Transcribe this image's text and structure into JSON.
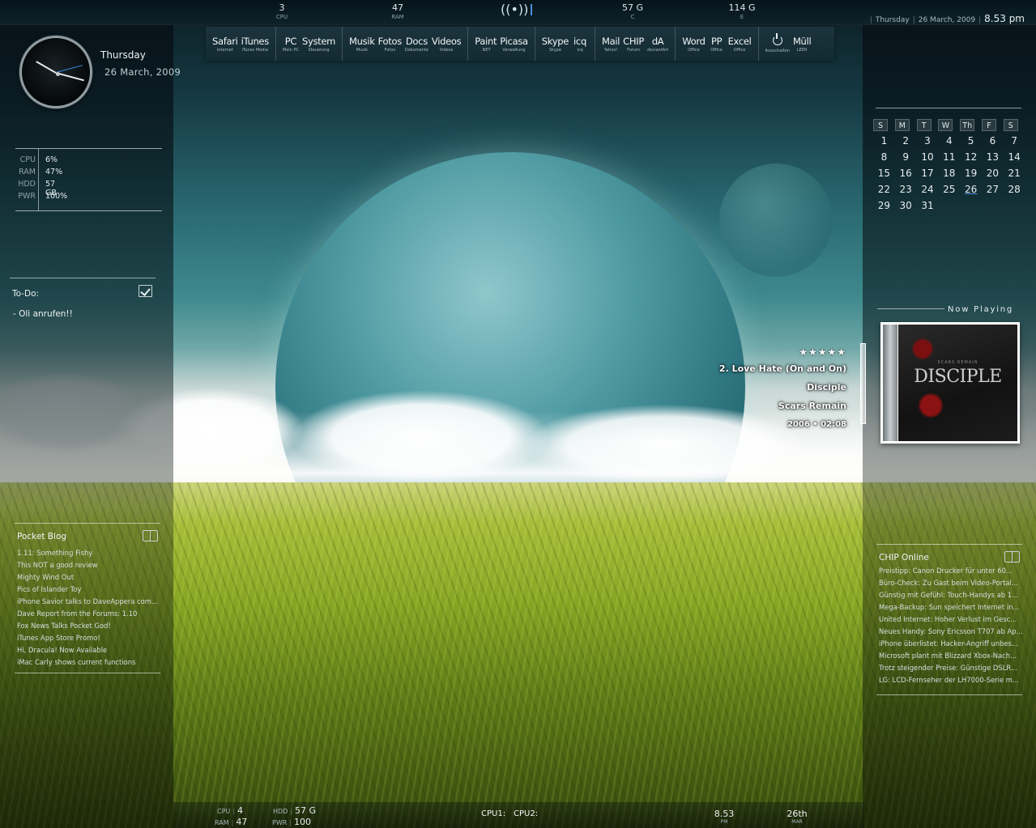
{
  "topbar": {
    "stats": [
      {
        "value": "3",
        "label": "CPU"
      },
      {
        "value": "47",
        "label": "RAM"
      },
      {
        "value": "57 G",
        "label": "C"
      },
      {
        "value": "114 G",
        "label": "E"
      }
    ],
    "date": "Thursday",
    "date_full": "26 March, 2009",
    "time": "8.53 pm"
  },
  "dock": {
    "groups": [
      [
        {
          "name": "Safari",
          "sub": "Internet"
        },
        {
          "name": "iTunes",
          "sub": "iTunes Media"
        }
      ],
      [
        {
          "name": "PC",
          "sub": "Mein PC"
        },
        {
          "name": "System",
          "sub": "Steuerung"
        }
      ],
      [
        {
          "name": "Musik",
          "sub": "Musik"
        },
        {
          "name": "Fotos",
          "sub": "Fotos"
        },
        {
          "name": "Docs",
          "sub": "Dokumente"
        },
        {
          "name": "Videos",
          "sub": "Videos"
        }
      ],
      [
        {
          "name": "Paint",
          "sub": ".NET"
        },
        {
          "name": "Picasa",
          "sub": "Verwaltung"
        }
      ],
      [
        {
          "name": "Skype",
          "sub": "Skype"
        },
        {
          "name": "icq",
          "sub": "icq"
        }
      ],
      [
        {
          "name": "Mail",
          "sub": "Yahoo!"
        },
        {
          "name": "CHIP",
          "sub": "Forum"
        },
        {
          "name": "dA",
          "sub": "deviantArt"
        }
      ],
      [
        {
          "name": "Word",
          "sub": "Office"
        },
        {
          "name": "PP",
          "sub": "Office"
        },
        {
          "name": "Excel",
          "sub": "Office"
        }
      ],
      [
        {
          "name": "",
          "sub": "Ausschalten",
          "icon": "power-icon"
        },
        {
          "name": "Müll",
          "sub": "LEER"
        }
      ]
    ]
  },
  "clock": {
    "day": "Thursday",
    "date": "26 March, 2009"
  },
  "system": {
    "rows": [
      {
        "label": "CPU",
        "value": "6%"
      },
      {
        "label": "RAM",
        "value": "47%"
      },
      {
        "label": "HDD",
        "value": "57 GB"
      },
      {
        "label": "PWR",
        "value": "100%"
      }
    ]
  },
  "todo": {
    "title": "To-Do:",
    "items": [
      "- Oli anrufen!!"
    ]
  },
  "pocket_blog": {
    "title": "Pocket Blog",
    "items": [
      "1.11: Something Fishy",
      "This NOT a good review",
      "Mighty Wind Out",
      "Pics of Islander Toy",
      "iPhone Savior talks to DaveAppera com...",
      "Dave Report from the Forums: 1.10",
      "Fox News Talks Pocket God!",
      "iTunes App Store Promo!",
      "Hi, Dracula! Now Available",
      "iMac Carly shows current functions"
    ]
  },
  "calendar": {
    "headers": [
      "S",
      "M",
      "T",
      "W",
      "Th",
      "F",
      "S"
    ],
    "weeks": [
      [
        "1",
        "2",
        "3",
        "4",
        "5",
        "6",
        "7"
      ],
      [
        "8",
        "9",
        "10",
        "11",
        "12",
        "13",
        "14"
      ],
      [
        "15",
        "16",
        "17",
        "18",
        "19",
        "20",
        "21"
      ],
      [
        "22",
        "23",
        "24",
        "25",
        "26",
        "27",
        "28"
      ],
      [
        "29",
        "30",
        "31",
        "",
        "",
        "",
        ""
      ]
    ],
    "today": "26"
  },
  "now_playing": {
    "title": "Now Playing",
    "rating": "★★★★★",
    "track": "2. Love Hate (On and On)",
    "artist": "Disciple",
    "album": "Scars Remain",
    "info": "2006 • 02:08",
    "cover_band": "DISCIPLE",
    "cover_small": "SCARS REMAIN"
  },
  "chip_online": {
    "title": "CHIP Online",
    "items": [
      "Preistipp: Canon Drucker für unter 60...",
      "Büro-Check: Zu Gast beim Video-Portal...",
      "Günstig mit Gefühl: Touch-Handys ab 1...",
      "Mega-Backup: Sun speichert Internet in...",
      "United Internet: Hoher Verlust im Gesc...",
      "Neues Handy: Sony Ericsson T707 ab Ap...",
      "iPhone überlistet: Hacker-Angriff unbes...",
      "Microsoft plant mit Blizzard Xbox-Nach...",
      "Trotz steigender Preise: Günstige DSLR...",
      "LG: LCD-Fernseher der LH7000-Serie m..."
    ]
  },
  "bottombar": {
    "cpu_label": "CPU",
    "cpu_value": "4",
    "ram_label": "RAM",
    "ram_value": "47",
    "hdd_label": "HDD",
    "hdd_value": "57 G",
    "pwr_label": "PWR",
    "pwr_value": "100",
    "cpu1": "CPU1:",
    "cpu2": "CPU2:",
    "time": "8.53",
    "time_label": "PM",
    "day": "26th",
    "month": "MAR"
  }
}
